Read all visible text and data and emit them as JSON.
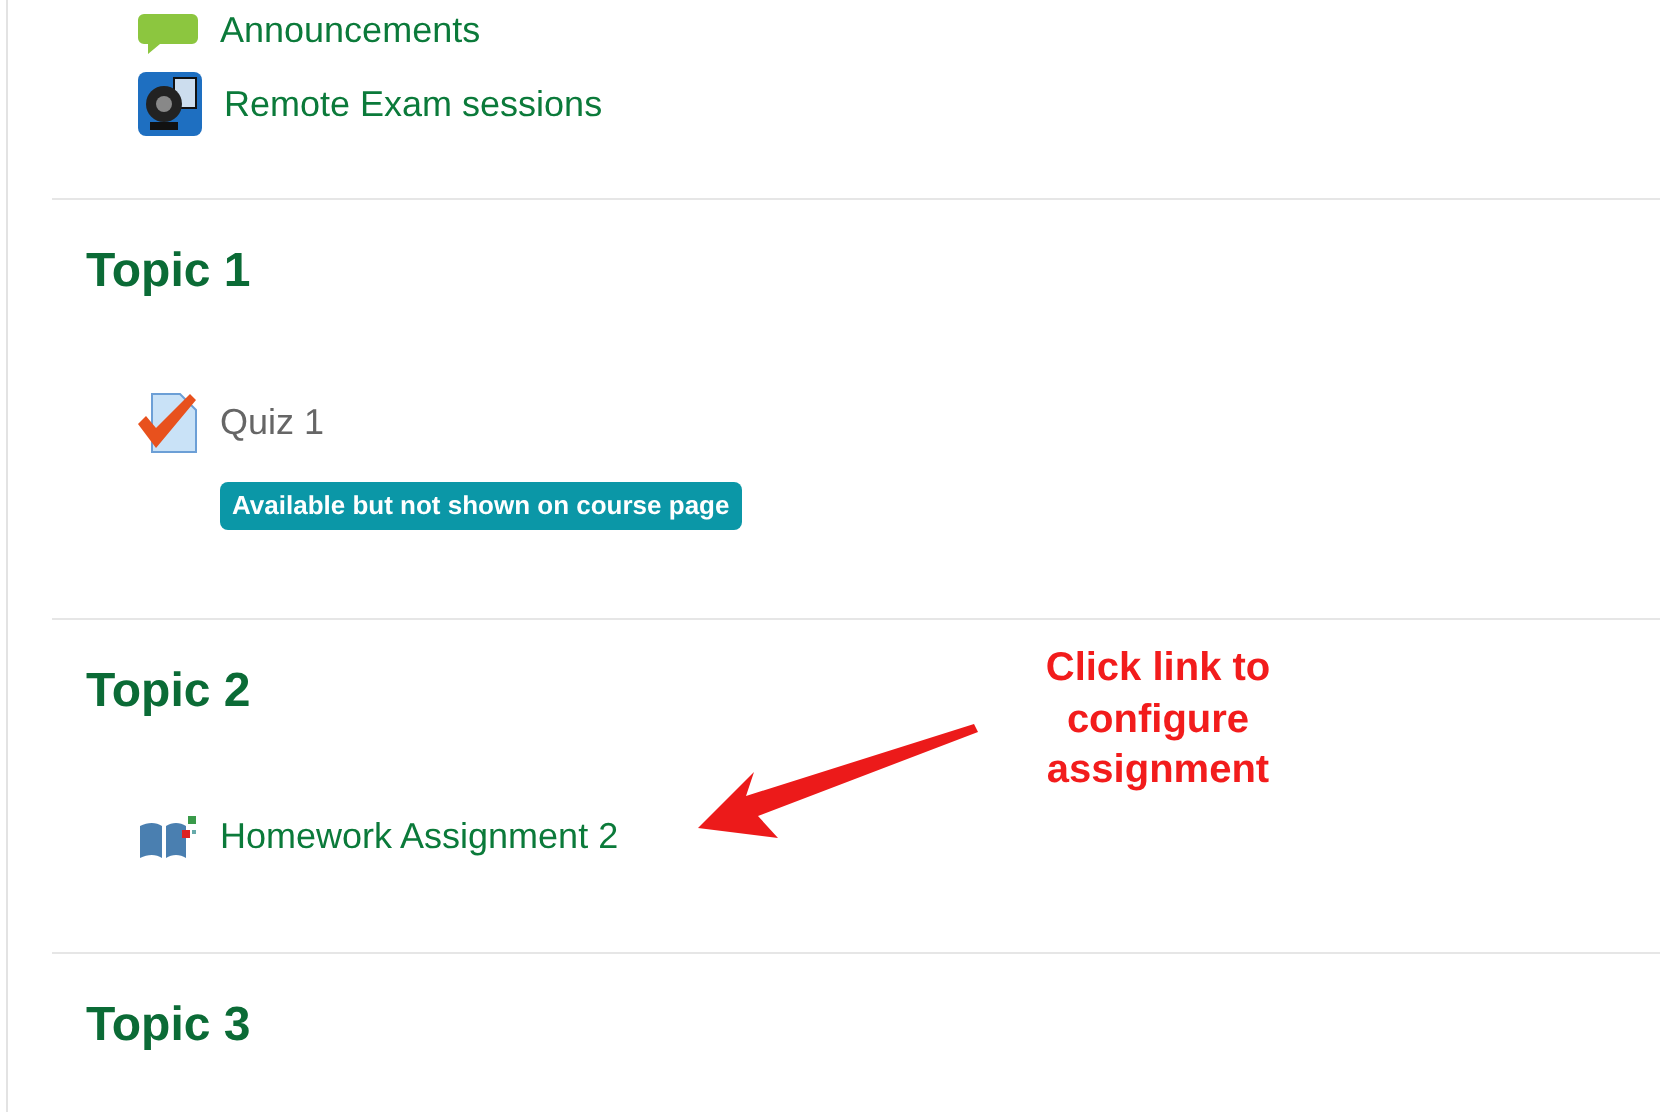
{
  "top_items": [
    {
      "kind": "forum",
      "title": "Announcements",
      "dimmed": false
    },
    {
      "kind": "exam",
      "title": "Remote Exam sessions",
      "dimmed": false
    }
  ],
  "sections": [
    {
      "title": "Topic 1",
      "activities": [
        {
          "kind": "quiz",
          "title": "Quiz 1",
          "dimmed": true,
          "badge": "Available but not shown on course page"
        }
      ]
    },
    {
      "title": "Topic 2",
      "activities": [
        {
          "kind": "assignment",
          "title": "Homework Assignment 2",
          "dimmed": false
        }
      ]
    },
    {
      "title": "Topic 3"
    }
  ],
  "callout": {
    "text": "Click link to configure assignment"
  }
}
